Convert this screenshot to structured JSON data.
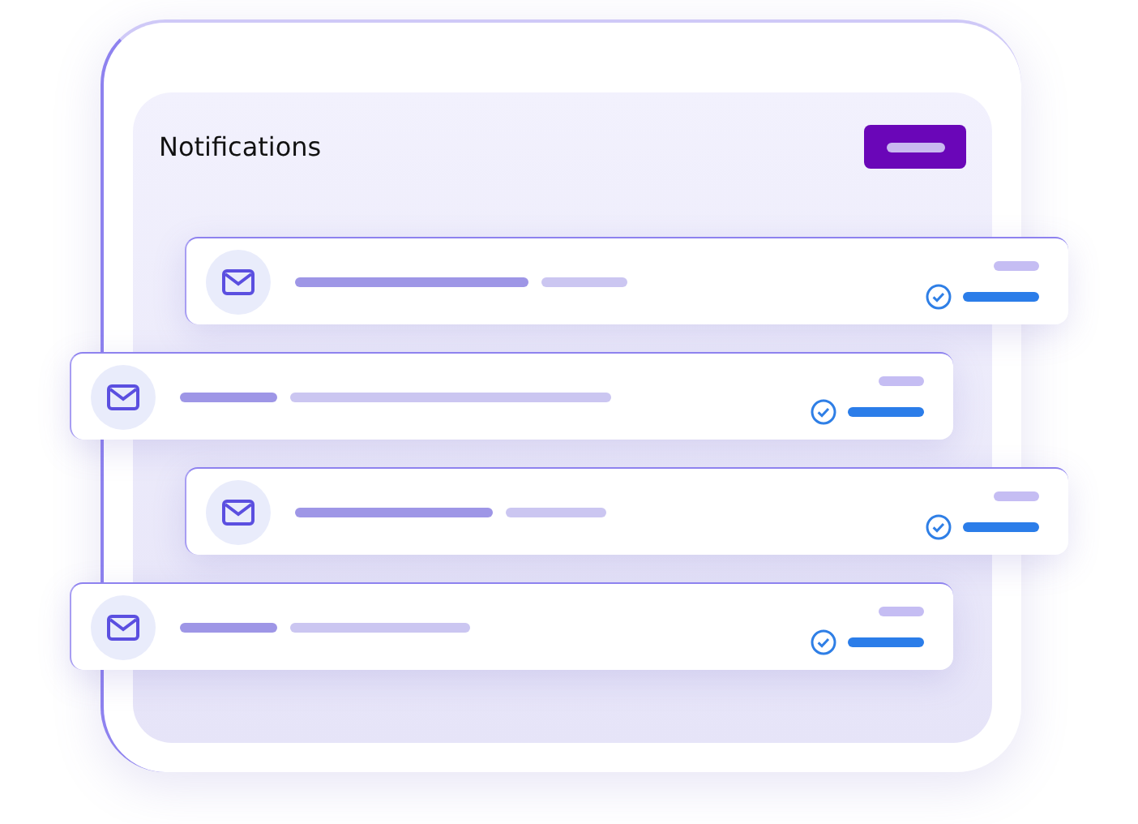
{
  "panel": {
    "title": "Notifications"
  },
  "notifications": [
    {
      "kind": "right"
    },
    {
      "kind": "left"
    },
    {
      "kind": "right"
    },
    {
      "kind": "left"
    }
  ]
}
